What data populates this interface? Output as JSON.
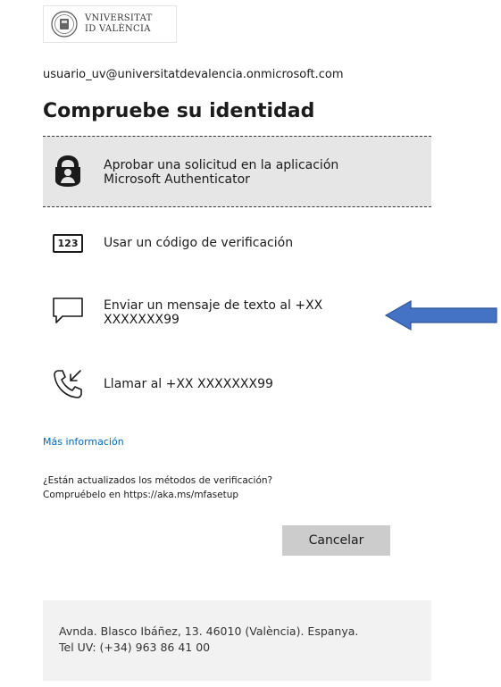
{
  "logo": {
    "line1": "VNIVERSITAT",
    "line2": "ID VALÈNCIA"
  },
  "account": "usuario_uv@universitatdevalencia.onmicrosoft.com",
  "title": "Compruebe su identidad",
  "options": [
    {
      "label_line1": "Aprobar una solicitud en la aplicación",
      "label_line2": "Microsoft Authenticator",
      "icon": "authenticator-lock-icon"
    },
    {
      "label": "Usar un código de verificación",
      "icon_text": "123",
      "icon": "verification-code-icon"
    },
    {
      "label_line1": "Enviar un mensaje de texto al +XX",
      "label_line2": "XXXXXXX99",
      "icon": "sms-bubble-icon"
    },
    {
      "label": "Llamar al +XX XXXXXXX99",
      "icon": "phone-call-icon"
    }
  ],
  "more_info": "Más información",
  "help_line1": "¿Están actualizados los métodos de verificación?",
  "help_line2": "Compruébelo en https://aka.ms/mfasetup",
  "cancel_label": "Cancelar",
  "footer_line1": "Avnda. Blasco Ibáñez, 13. 46010 (València). Espanya.",
  "footer_line2": "Tel UV: (+34) 963 86 41 00",
  "colors": {
    "link": "#0067b8",
    "arrow": "#4472c4",
    "selected_bg": "#e6e6e6",
    "button_bg": "#cccccc",
    "footer_bg": "#f2f2f2"
  }
}
